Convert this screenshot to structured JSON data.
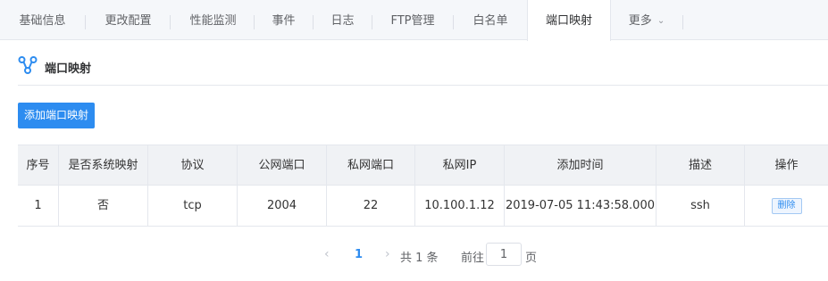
{
  "tabs": [
    {
      "label": "基础信息"
    },
    {
      "label": "更改配置"
    },
    {
      "label": "性能监测"
    },
    {
      "label": "事件"
    },
    {
      "label": "日志"
    },
    {
      "label": "FTP管理"
    },
    {
      "label": "白名单"
    },
    {
      "label": "端口映射",
      "active": true
    },
    {
      "label": "更多"
    }
  ],
  "section": {
    "title": "端口映射",
    "icon": "network-branch-icon"
  },
  "toolbar": {
    "add_label": "添加端口映射"
  },
  "table": {
    "columns": [
      "序号",
      "是否系统映射",
      "协议",
      "公网端口",
      "私网端口",
      "私网IP",
      "添加时间",
      "描述",
      "操作"
    ],
    "rows": [
      {
        "index": "1",
        "is_system": "否",
        "protocol": "tcp",
        "public_port": "2004",
        "private_port": "22",
        "private_ip": "10.100.1.12",
        "added_time": "2019-07-05 11:43:58.000",
        "description": "ssh",
        "action_label": "删除"
      }
    ]
  },
  "pagination": {
    "current_page": "1",
    "total_text": "共 1 条",
    "goto_label": "前往",
    "goto_value": "1",
    "page_suffix": "页"
  },
  "colors": {
    "accent": "#2d8cf0",
    "tab_bg": "#f5f7fa",
    "header_bg": "#f0f2f5"
  }
}
